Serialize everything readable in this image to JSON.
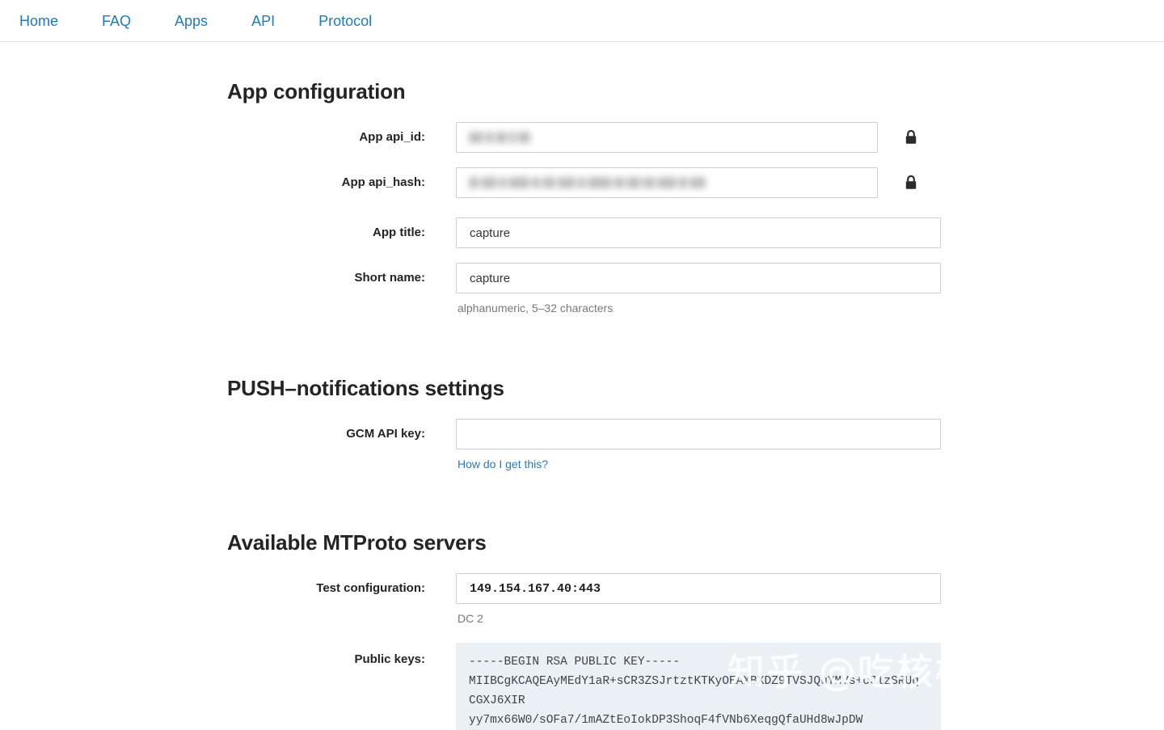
{
  "nav": {
    "items": [
      {
        "label": "Home"
      },
      {
        "label": "FAQ"
      },
      {
        "label": "Apps"
      },
      {
        "label": "API"
      },
      {
        "label": "Protocol"
      }
    ]
  },
  "app_configuration": {
    "title": "App configuration",
    "fields": {
      "api_id": {
        "label": "App api_id:",
        "value": "",
        "redacted": true,
        "lock_icon": "lock-icon"
      },
      "api_hash": {
        "label": "App api_hash:",
        "value": "",
        "redacted": true,
        "lock_icon": "lock-icon"
      },
      "app_title": {
        "label": "App title:",
        "value": "capture"
      },
      "short_name": {
        "label": "Short name:",
        "value": "capture",
        "helper": "alphanumeric, 5–32 characters"
      }
    }
  },
  "push_notifications": {
    "title": "PUSH–notifications settings",
    "fields": {
      "gcm_api_key": {
        "label": "GCM API key:",
        "value": "",
        "placeholder": "",
        "helper_link": "How do I get this?"
      }
    }
  },
  "mtproto": {
    "title": "Available MTProto servers",
    "fields": {
      "test_configuration": {
        "label": "Test configuration:",
        "value": "149.154.167.40:443",
        "helper": "DC 2"
      },
      "public_keys": {
        "label": "Public keys:",
        "value": "-----BEGIN RSA PUBLIC KEY-----\nMIIBCgKCAQEAyMEdY1aR+sCR3ZSJrtztKTKyOEAXBXDZ9TVSJQuYMVs+cJlzSRUq\nCGXJ6XIR\nyy7mx66W0/sOFa7/1mAZtEoIokDP3ShoqF4fVNb6XeqgQfaUHd8wJpDW"
      }
    }
  },
  "colors": {
    "link": "#1f7bb6",
    "helper_link": "#2b7bb9",
    "heading": "#242424",
    "helper_text": "#787878",
    "keys_background": "#eaf0f4",
    "input_border": "#cfcfcf"
  },
  "watermark": {
    "text": "知乎 @吃核桃不吐核桃壳"
  }
}
